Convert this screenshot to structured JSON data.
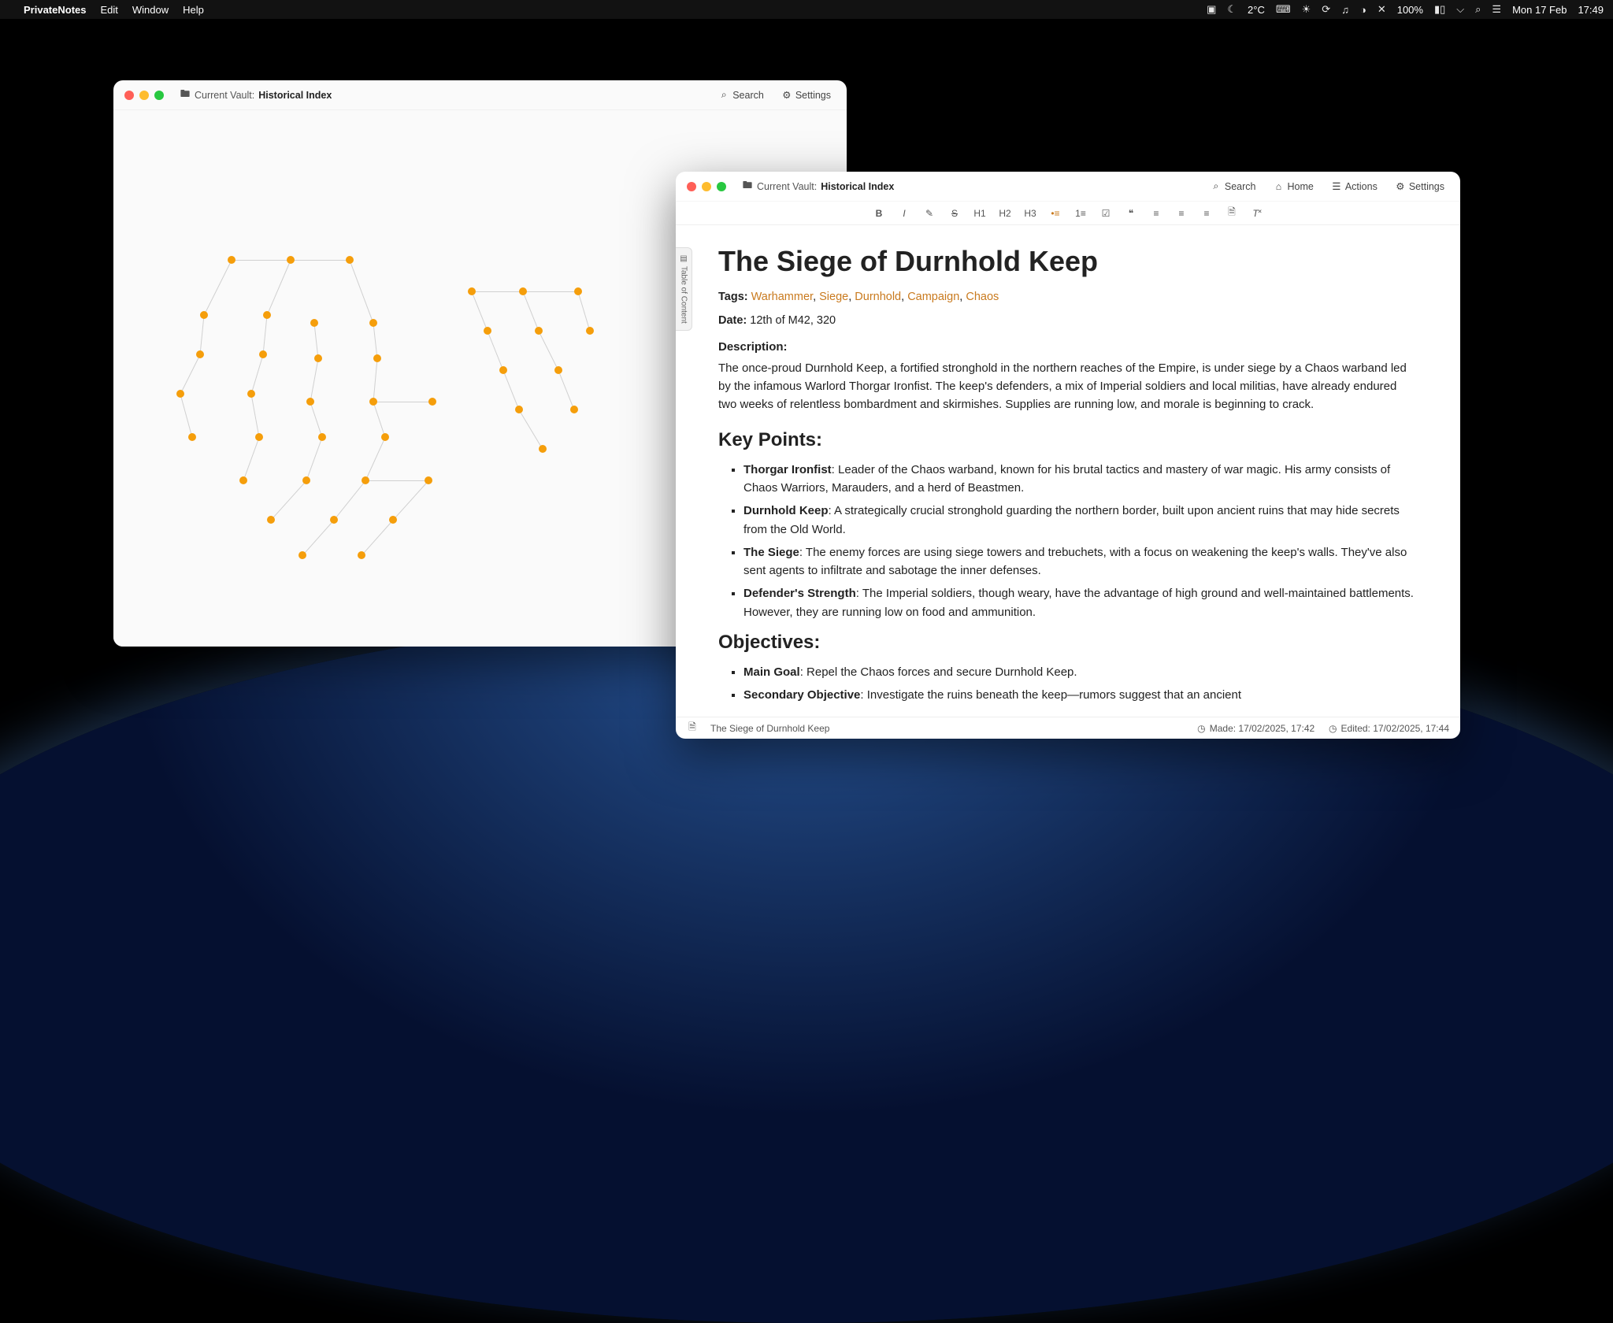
{
  "menubar": {
    "app": "PrivateNotes",
    "items": [
      "Edit",
      "Window",
      "Help"
    ],
    "temp": "2°C",
    "battery": "100%",
    "date": "Mon 17 Feb",
    "time": "17:49"
  },
  "window_a": {
    "vault_prefix": "Current Vault:",
    "vault_name": "Historical Index",
    "search": "Search",
    "settings": "Settings"
  },
  "window_b": {
    "vault_prefix": "Current Vault:",
    "vault_name": "Historical Index",
    "search": "Search",
    "home": "Home",
    "actions": "Actions",
    "settings": "Settings",
    "toc": "Table of Content"
  },
  "toolbar": {
    "h1": "H1",
    "h2": "H2",
    "h3": "H3"
  },
  "doc": {
    "title": "The Siege of Durnhold Keep",
    "tags_label": "Tags:",
    "tags": [
      "Warhammer",
      "Siege",
      "Durnhold",
      "Campaign",
      "Chaos"
    ],
    "date_label": "Date:",
    "date_value": "12th of M42, 320",
    "desc_label": "Description:",
    "description": "The once-proud Durnhold Keep, a fortified stronghold in the northern reaches of the Empire, is under siege by a Chaos warband led by the infamous Warlord Thorgar Ironfist. The keep's defenders, a mix of Imperial soldiers and local militias, have already endured two weeks of relentless bombardment and skirmishes. Supplies are running low, and morale is beginning to crack.",
    "key_points_header": "Key Points:",
    "key_points": [
      {
        "term": "Thorgar Ironfist",
        "text": ": Leader of the Chaos warband, known for his brutal tactics and mastery of war magic. His army consists of Chaos Warriors, Marauders, and a herd of Beastmen."
      },
      {
        "term": "Durnhold Keep",
        "text": ": A strategically crucial stronghold guarding the northern border, built upon ancient ruins that may hide secrets from the Old World."
      },
      {
        "term": "The Siege",
        "text": ": The enemy forces are using siege towers and trebuchets, with a focus on weakening the keep's walls. They've also sent agents to infiltrate and sabotage the inner defenses."
      },
      {
        "term": "Defender's Strength",
        "text": ": The Imperial soldiers, though weary, have the advantage of high ground and well-maintained battlements. However, they are running low on food and ammunition."
      }
    ],
    "objectives_header": "Objectives:",
    "objectives": [
      {
        "term": "Main Goal",
        "text": ": Repel the Chaos forces and secure Durnhold Keep."
      },
      {
        "term": "Secondary Objective",
        "text": ": Investigate the ruins beneath the keep—rumors suggest that an ancient"
      }
    ]
  },
  "status": {
    "filename": "The Siege of Durnhold Keep",
    "made_label": "Made:",
    "made_value": "17/02/2025, 17:42",
    "edited_label": "Edited:",
    "edited_value": "17/02/2025, 17:44"
  }
}
